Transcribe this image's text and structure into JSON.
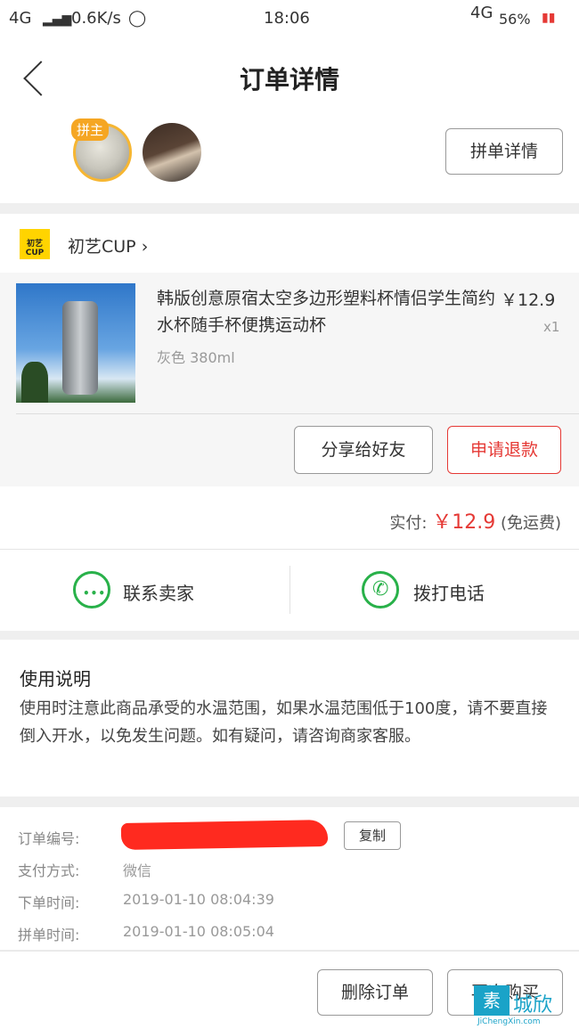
{
  "status_bar": {
    "network_left": "4G",
    "speed": "0.6K/s",
    "time": "18:06",
    "network_right": "4G",
    "battery": "56%"
  },
  "header": {
    "title": "订单详情"
  },
  "group": {
    "host_badge": "拼主",
    "details_button": "拼单详情"
  },
  "shop": {
    "logo_text": "初艺CUP",
    "name": "初艺CUP"
  },
  "product": {
    "title": "韩版创意原宿太空多边形塑料杯情侣学生简约水杯随手杯便携运动杯",
    "variant": "灰色 380ml",
    "price": "￥12.9",
    "quantity": "x1",
    "share_button": "分享给好友",
    "refund_button": "申请退款"
  },
  "payment": {
    "label": "实付:",
    "amount": "￥12.9",
    "note": "(免运费)"
  },
  "contact": {
    "seller_label": "联系卖家",
    "call_label": "拨打电话"
  },
  "notes": {
    "title": "使用说明",
    "body": "使用时注意此商品承受的水温范围，如果水温范围低于100度，请不要直接倒入开水，以免发生问题。如有疑问，请咨询商家客服。"
  },
  "order_info": {
    "order_no_label": "订单编号:",
    "copy_button": "复制",
    "pay_method_label": "支付方式:",
    "pay_method": "微信",
    "order_time_label": "下单时间:",
    "order_time": "2019-01-10 08:04:39",
    "group_time_label": "拼单时间:",
    "group_time": "2019-01-10 08:05:04"
  },
  "footer": {
    "delete_button": "删除订单",
    "rebuy_button": "再次购买"
  },
  "watermark": {
    "box": "素",
    "text": "城欣",
    "url": "JiChengXin.com"
  },
  "colors": {
    "accent_red": "#e53935",
    "green": "#29b14a",
    "badge": "#f5a623"
  }
}
